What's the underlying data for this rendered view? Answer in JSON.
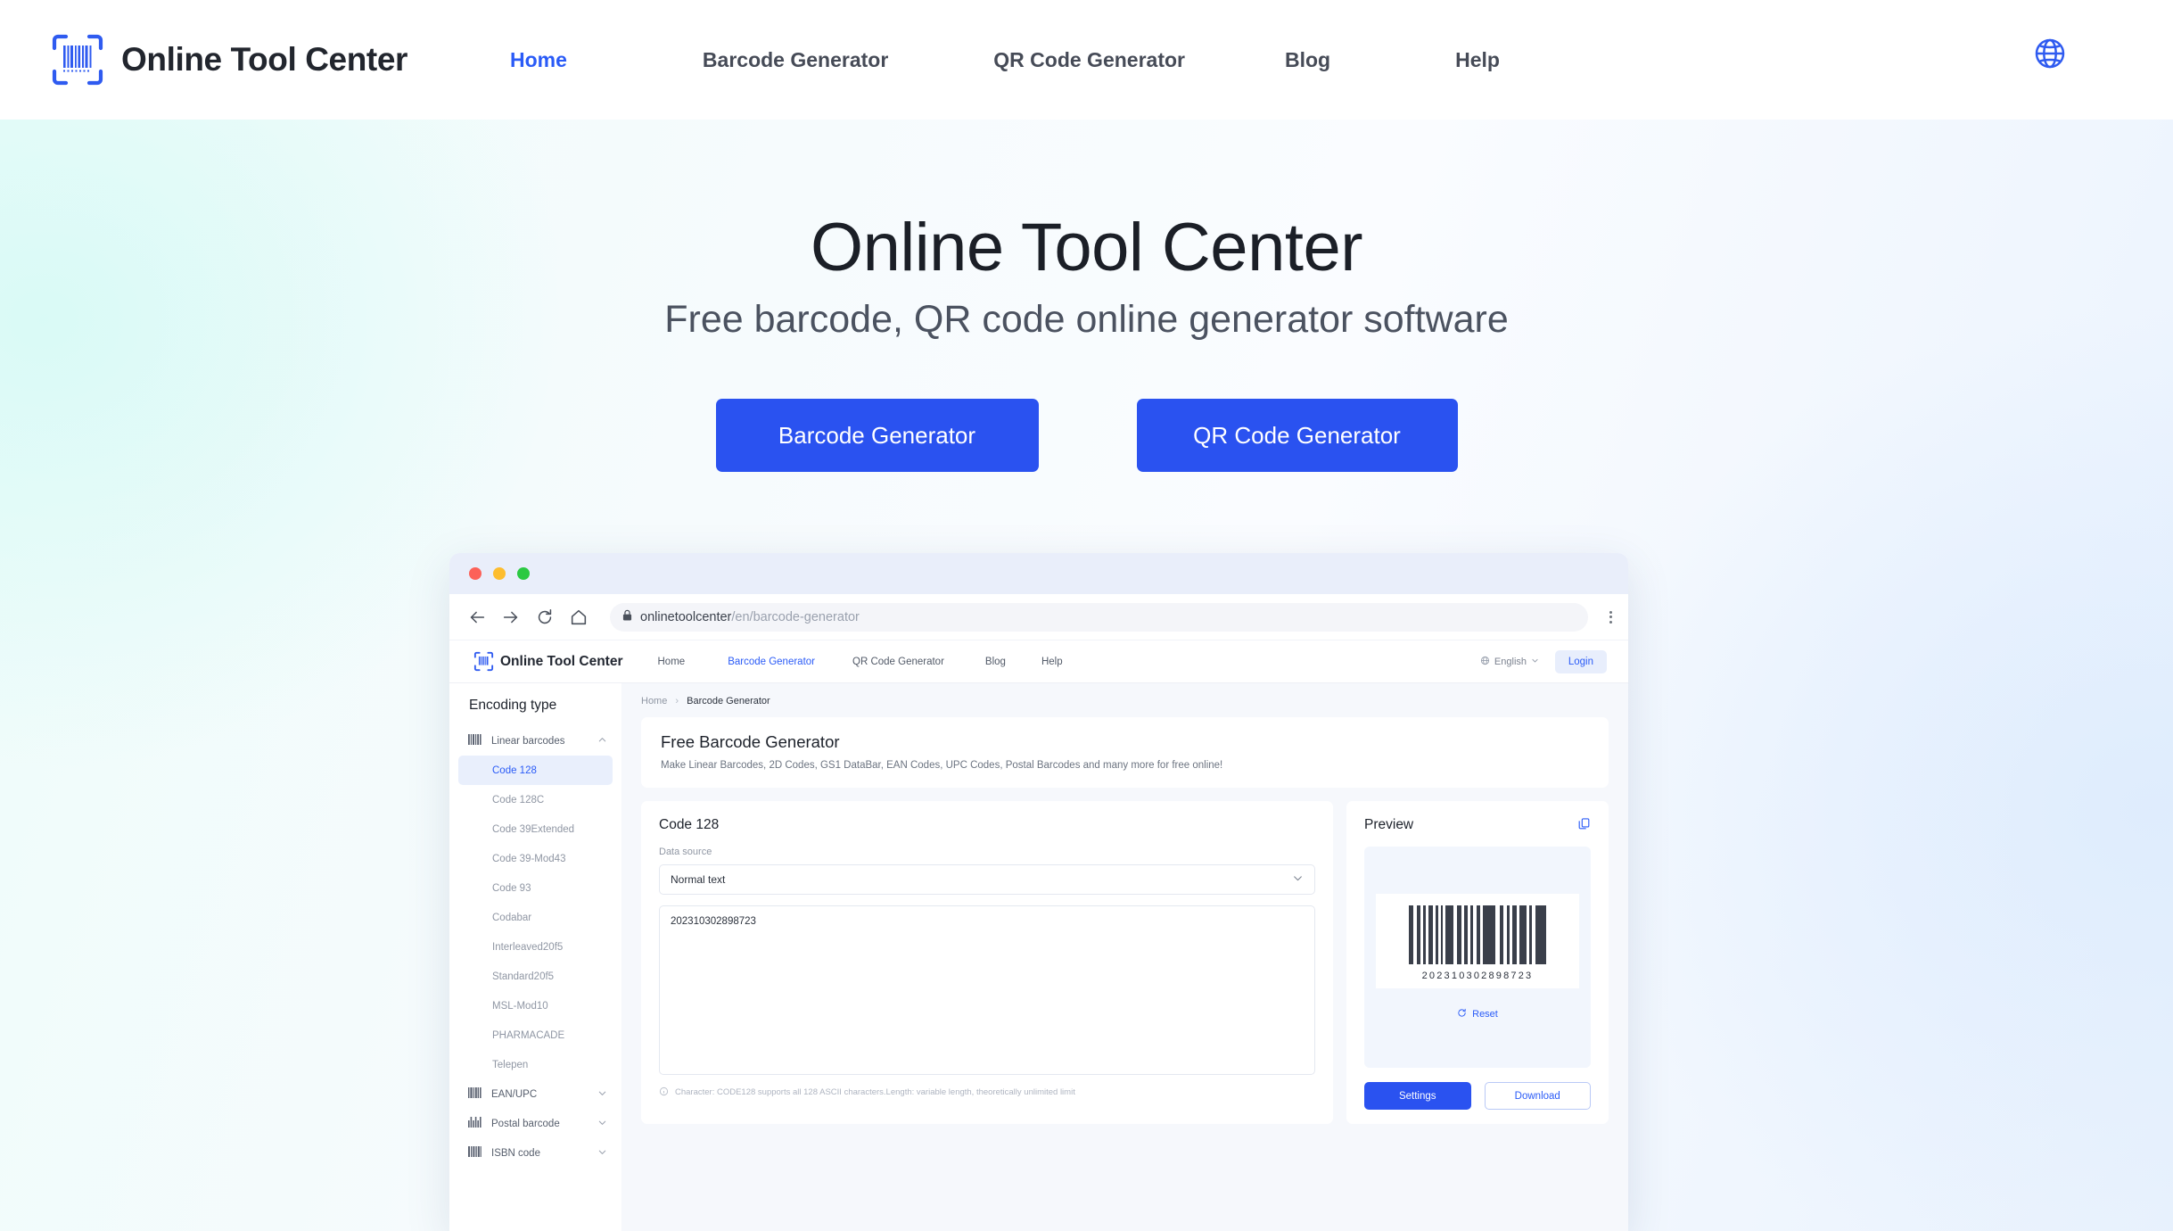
{
  "header": {
    "brand": "Online Tool Center",
    "brand_icon": "barcode-icon",
    "nav": [
      {
        "label": "Home",
        "active": true
      },
      {
        "label": "Barcode Generator",
        "active": false
      },
      {
        "label": "QR Code Generator",
        "active": false
      },
      {
        "label": "Blog",
        "active": false
      },
      {
        "label": "Help",
        "active": false
      }
    ],
    "language_icon": "globe-icon"
  },
  "hero": {
    "title": "Online Tool Center",
    "subtitle": "Free barcode, QR code online generator software",
    "cta_primary": "Barcode Generator",
    "cta_secondary": "QR Code Generator"
  },
  "browser_mock": {
    "traffic_lights": [
      "close-red",
      "minimize-yellow",
      "maximize-green"
    ],
    "toolbar_icons": [
      "back-arrow-icon",
      "forward-arrow-icon",
      "reload-icon",
      "home-icon"
    ],
    "lock_icon": "lock-icon",
    "url_host": "onlinetoolcenter",
    "url_path": "/en/barcode-generator",
    "menu_icon": "kebab-menu-icon",
    "site": {
      "brand": "Online Tool Center",
      "nav": [
        {
          "label": "Home",
          "active": false
        },
        {
          "label": "Barcode Generator",
          "active": true
        },
        {
          "label": "QR Code Generator",
          "active": false
        },
        {
          "label": "Blog",
          "active": false
        },
        {
          "label": "Help",
          "active": false
        }
      ],
      "language": "English",
      "language_caret": "⌄",
      "login_label": "Login",
      "sidebar": {
        "title": "Encoding type",
        "groups": [
          {
            "label": "Linear barcodes",
            "icon": "barcode-icon",
            "expanded": true,
            "caret": "expand-less-icon",
            "items": [
              {
                "label": "Code 128",
                "selected": true
              },
              {
                "label": "Code 128C",
                "selected": false
              },
              {
                "label": "Code 39Extended",
                "selected": false
              },
              {
                "label": "Code 39-Mod43",
                "selected": false
              },
              {
                "label": "Code 93",
                "selected": false
              },
              {
                "label": "Codabar",
                "selected": false
              },
              {
                "label": "Interleaved20f5",
                "selected": false
              },
              {
                "label": "Standard20f5",
                "selected": false
              },
              {
                "label": "MSL-Mod10",
                "selected": false
              },
              {
                "label": "PHARMACADE",
                "selected": false
              },
              {
                "label": "Telepen",
                "selected": false
              }
            ]
          },
          {
            "label": "EAN/UPC",
            "icon": "barcode-icon",
            "expanded": false,
            "caret": "expand-more-icon",
            "items": []
          },
          {
            "label": "Postal barcode",
            "icon": "postal-barcode-icon",
            "expanded": false,
            "caret": "expand-more-icon",
            "items": []
          },
          {
            "label": "ISBN code",
            "icon": "barcode-icon",
            "expanded": false,
            "caret": "expand-more-icon",
            "items": []
          }
        ]
      },
      "breadcrumb": {
        "root": "Home",
        "separator": "›",
        "current": "Barcode Generator"
      },
      "intro": {
        "title": "Free Barcode Generator",
        "description": "Make Linear Barcodes, 2D Codes, GS1 DataBar, EAN Codes, UPC Codes, Postal Barcodes and many more for free online!"
      },
      "editor": {
        "title": "Code 128",
        "data_source_label": "Data source",
        "data_source_value": "Normal text",
        "data_source_caret": "chevron-down-icon",
        "input_value": "202310302898723",
        "hint_icon": "info-circle-icon",
        "hint": "Character: CODE128 supports all 128 ASCII characters.Length: variable length, theoretically unlimited limit"
      },
      "preview": {
        "title": "Preview",
        "copy_icon": "copy-icon",
        "barcode_digits": "202310302898723",
        "reset_icon": "refresh-icon",
        "reset_label": "Reset",
        "settings_label": "Settings",
        "download_label": "Download"
      }
    }
  },
  "colors": {
    "accent_blue": "#2a52f0",
    "link_blue": "#2a5bf7",
    "text_dark": "#1d222b",
    "text_muted": "#8f96a3"
  }
}
